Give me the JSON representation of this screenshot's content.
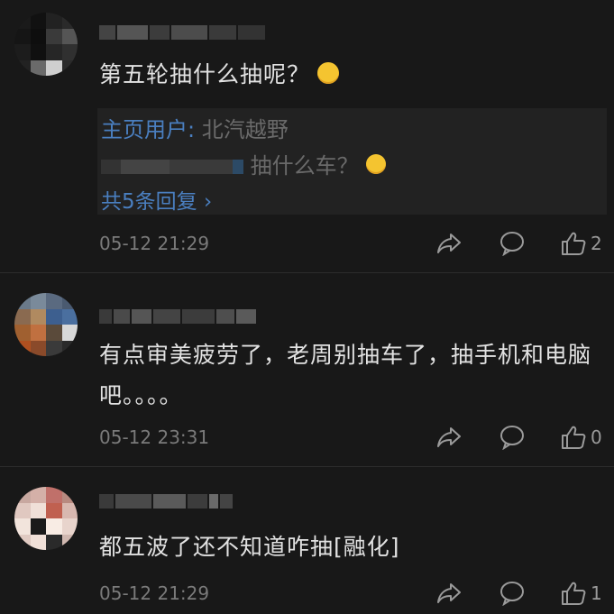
{
  "comments": [
    {
      "text": "第五轮抽什么抽呢？",
      "emoji": "smiling-face-emoji",
      "reply_preview": {
        "author_label": "主页用户",
        "separator": ":",
        "author_name": "北汽越野",
        "reply_text": "抽什么车？",
        "reply_emoji": "laughing-tears-emoji",
        "more_label": "共5条回复 ›"
      },
      "time": "05-12 21:29",
      "likes": "2"
    },
    {
      "text": "有点审美疲劳了，老周别抽车了，抽手机和电脑吧。。。。",
      "time": "05-12 23:31",
      "likes": "0"
    },
    {
      "text": "都五波了还不知道咋抽[融化]",
      "time": "05-12 21:29",
      "likes": "1"
    }
  ],
  "colors": {
    "background": "#181818",
    "link": "#4a7fc0",
    "muted": "#7a7a7a"
  },
  "icons": [
    "share-icon",
    "comment-icon",
    "thumbs-up-icon"
  ]
}
